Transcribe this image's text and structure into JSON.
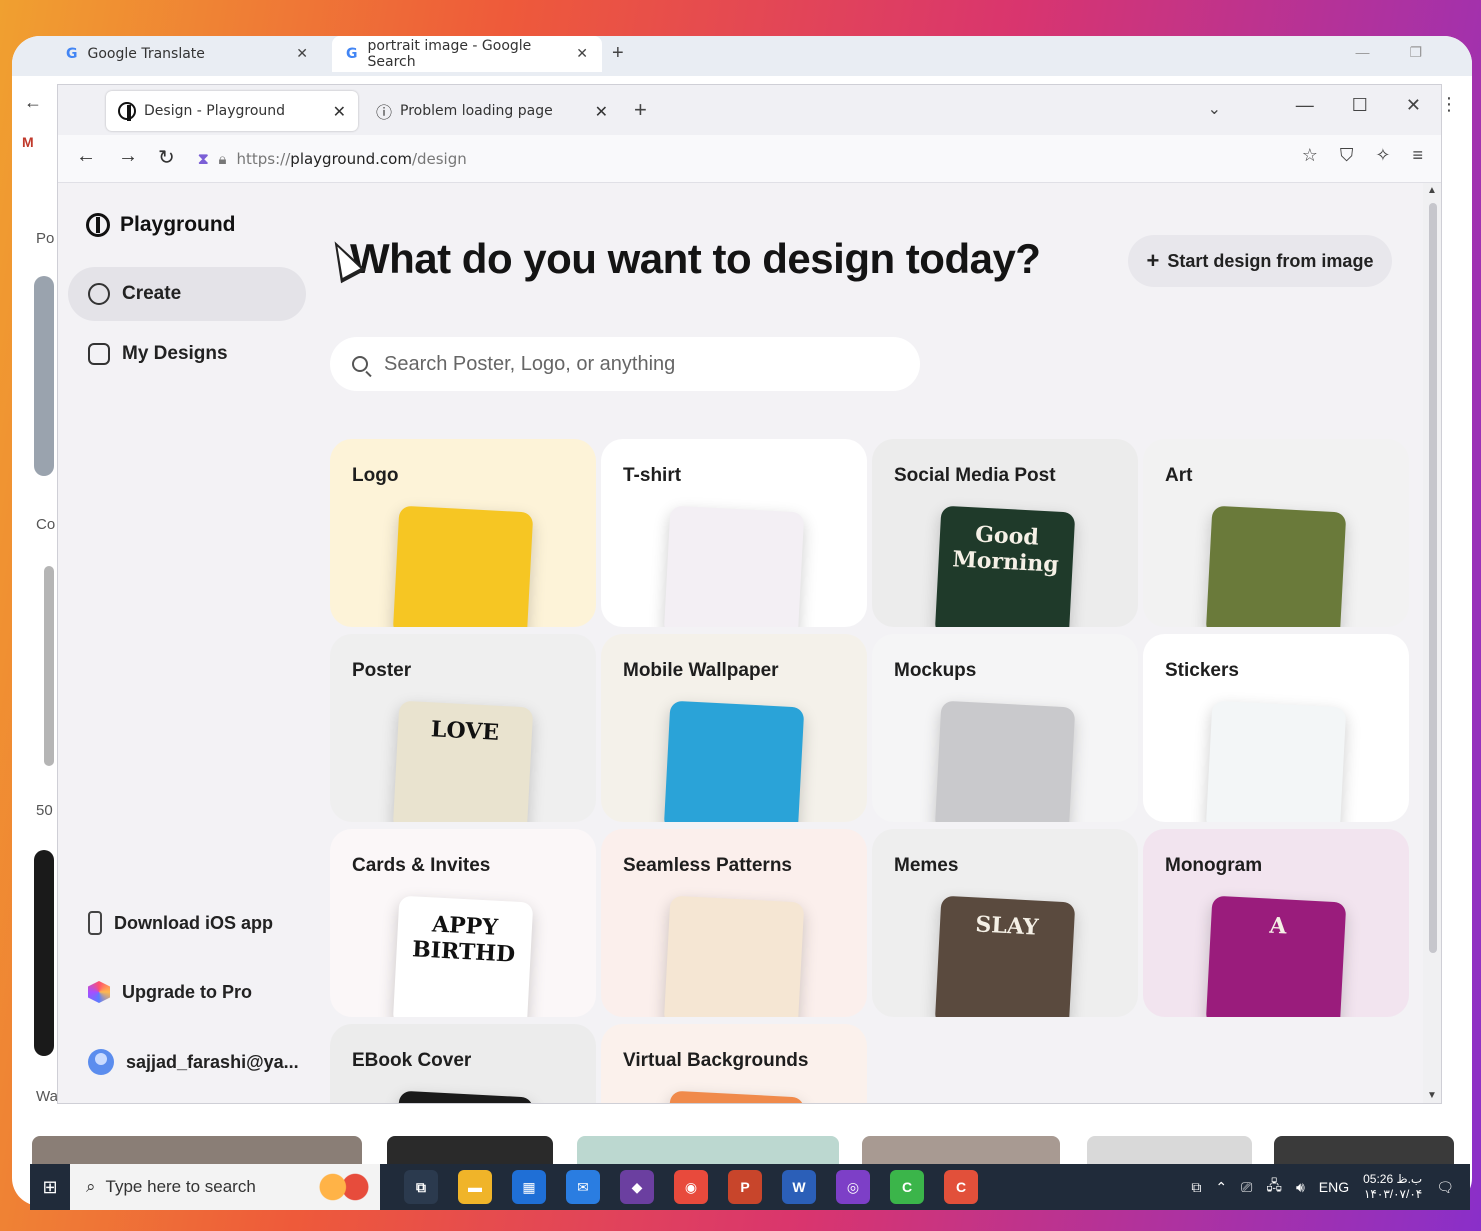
{
  "outer_browser": {
    "tabs": [
      {
        "label": "Google Translate"
      },
      {
        "label": "portrait image - Google Search"
      }
    ],
    "side_snippets": [
      "Po",
      "Co",
      "50",
      "Wa"
    ]
  },
  "browser": {
    "tabs": [
      {
        "label": "Design - Playground",
        "active": true
      },
      {
        "label": "Problem loading page",
        "active": false
      }
    ],
    "url": {
      "scheme": "https://",
      "host": "playground.com",
      "path": "/design"
    }
  },
  "sidebar": {
    "brand": "Playground",
    "nav": [
      {
        "label": "Create",
        "icon": "palette-icon",
        "active": true
      },
      {
        "label": "My Designs",
        "icon": "images-icon",
        "active": false
      }
    ],
    "footer": {
      "download": "Download iOS app",
      "upgrade": "Upgrade to Pro",
      "user": "sajjad_farashi@ya..."
    }
  },
  "main": {
    "headline": "What do you want to design today?",
    "start_button": "Start design from image",
    "search_placeholder": "Search Poster, Logo, or anything",
    "categories": [
      {
        "title": "Logo",
        "bg": "#fdf3d8",
        "art": "#f6c623"
      },
      {
        "title": "T-shirt",
        "bg": "#ffffff",
        "art": "#f3eff4"
      },
      {
        "title": "Social Media Post",
        "bg": "#ececec",
        "art": "#1f3a2a",
        "art_text": "Good Morning"
      },
      {
        "title": "Art",
        "bg": "#f2f2f2",
        "art": "#6a7a3a"
      },
      {
        "title": "Poster",
        "bg": "#efefef",
        "art": "#e9e3cf",
        "art_text": "LOVE"
      },
      {
        "title": "Mobile Wallpaper",
        "bg": "#f4f1ea",
        "art": "#2aa3d8"
      },
      {
        "title": "Mockups",
        "bg": "#f5f5f6",
        "art": "#c9c9cc"
      },
      {
        "title": "Stickers",
        "bg": "#ffffff",
        "art": "#f3f6f7"
      },
      {
        "title": "Cards & Invites",
        "bg": "#fbf7f8",
        "art": "#ffffff",
        "art_text": "APPY BIRTHD"
      },
      {
        "title": "Seamless Patterns",
        "bg": "#fbefec",
        "art": "#f5e6d3"
      },
      {
        "title": "Memes",
        "bg": "#eeeeee",
        "art": "#5a4a3e",
        "art_text": "SLAY"
      },
      {
        "title": "Monogram",
        "bg": "#f2e4ef",
        "art": "#9a1c7c",
        "art_text": "A"
      },
      {
        "title": "EBook Cover",
        "bg": "#ececec",
        "art": "#1a1a1a"
      },
      {
        "title": "Virtual Backgrounds",
        "bg": "#fbf1ec",
        "art": "#f08a4b"
      }
    ]
  },
  "taskbar": {
    "search_placeholder": "Type here to search",
    "lang": "ENG",
    "time": "05:26 ب.ظ",
    "date": "۱۴۰۳/۰۷/۰۴",
    "apps": [
      {
        "name": "task-view",
        "color": "#2b3a4e",
        "label": "⧉"
      },
      {
        "name": "file-explorer",
        "color": "#f0b429",
        "label": "▬"
      },
      {
        "name": "store",
        "color": "#1f6fd6",
        "label": "▦"
      },
      {
        "name": "mail",
        "color": "#2a7de1",
        "label": "✉"
      },
      {
        "name": "git",
        "color": "#6b3fa0",
        "label": "◆"
      },
      {
        "name": "chrome",
        "color": "#e84a3c",
        "label": "◉"
      },
      {
        "name": "powerpoint",
        "color": "#c8452b",
        "label": "P"
      },
      {
        "name": "word",
        "color": "#2b5fb8",
        "label": "W"
      },
      {
        "name": "tor",
        "color": "#7d3fc7",
        "label": "◎"
      },
      {
        "name": "camtasia-green",
        "color": "#3bb54a",
        "label": "C"
      },
      {
        "name": "camtasia-red",
        "color": "#e2503a",
        "label": "C"
      }
    ]
  }
}
